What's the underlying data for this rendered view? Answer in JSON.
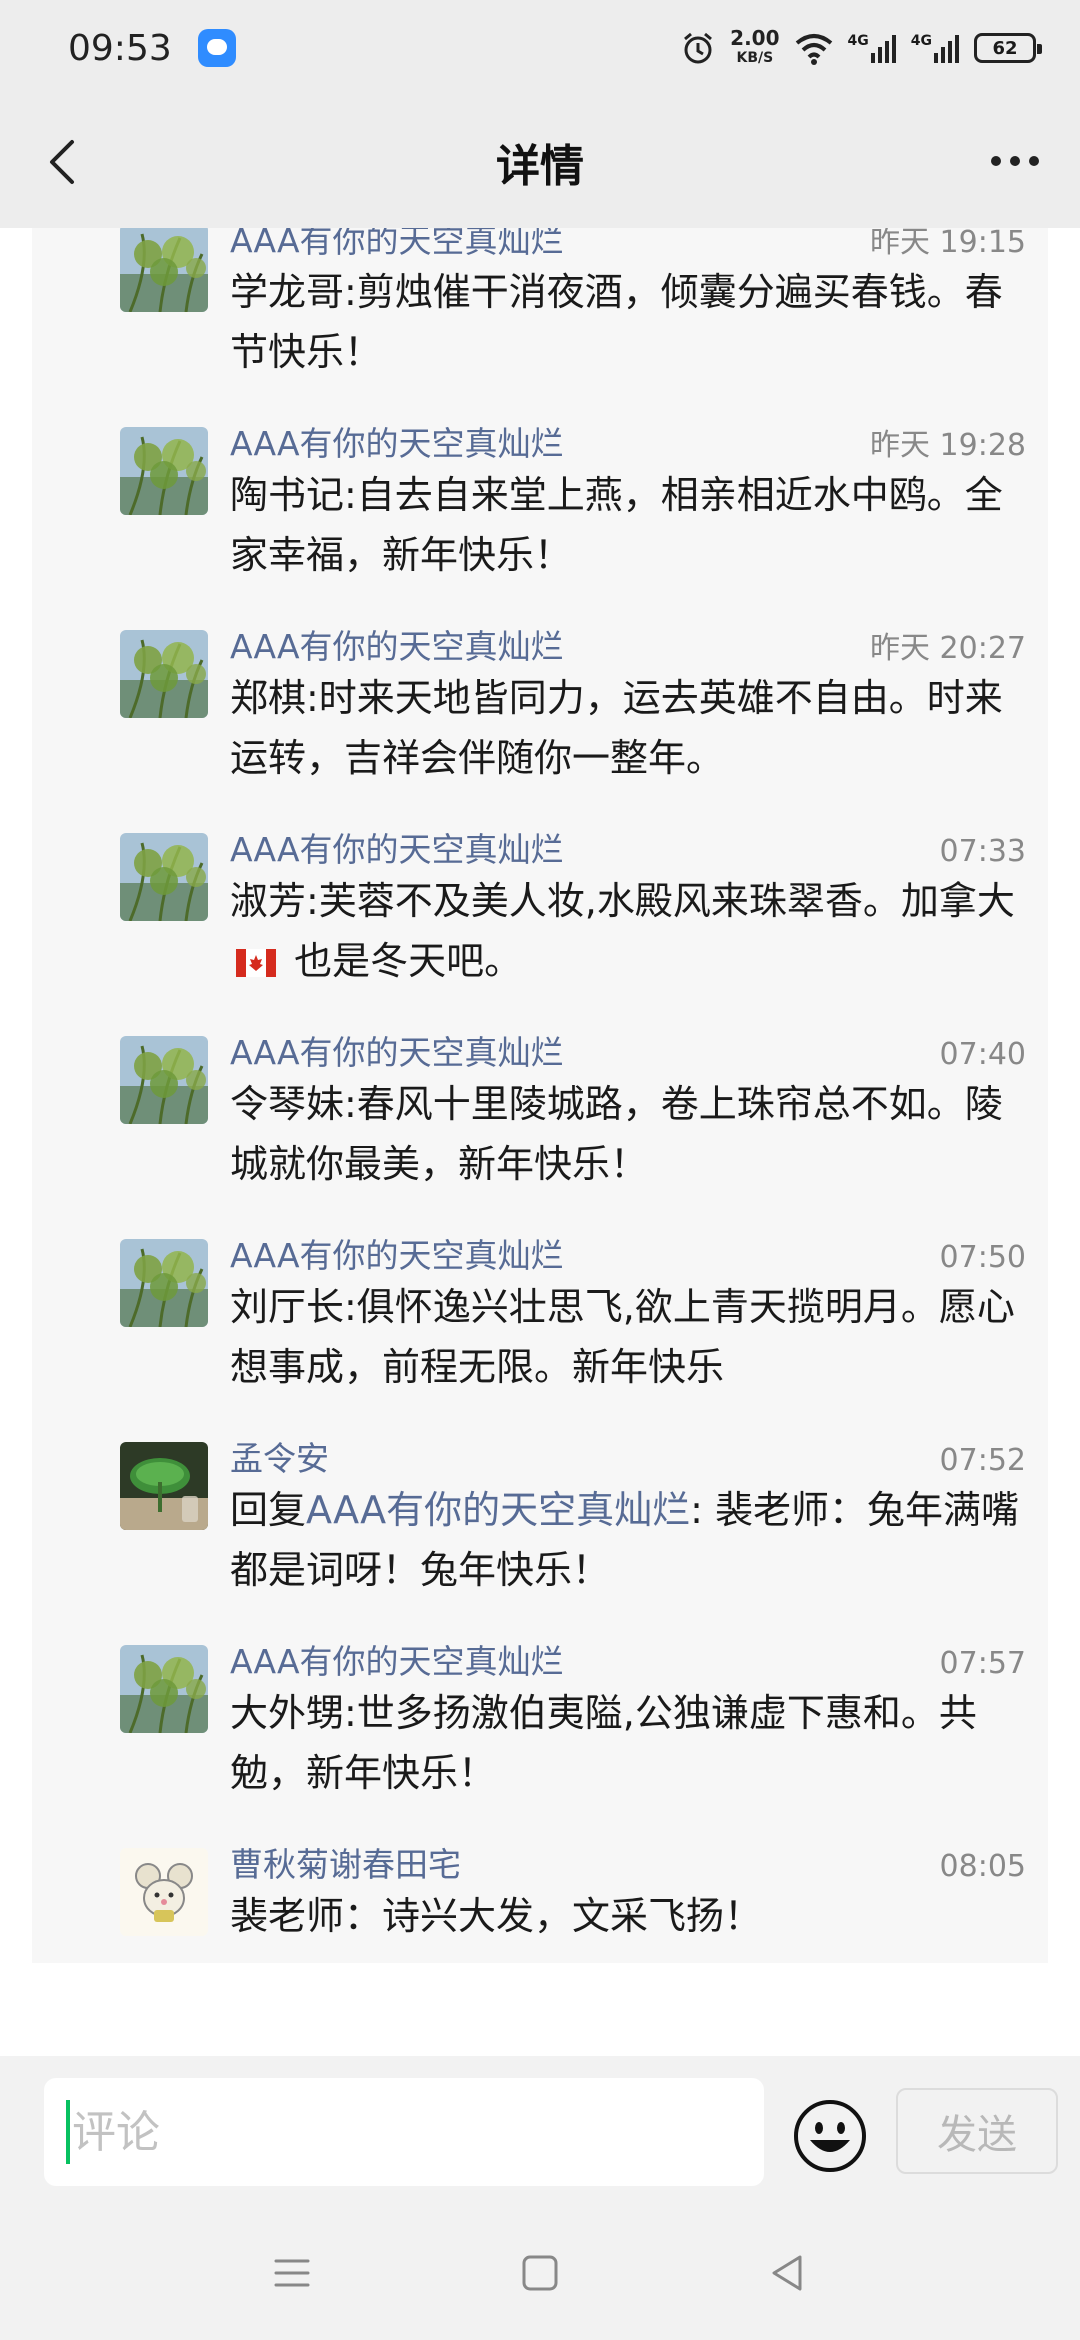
{
  "status_bar": {
    "time": "09:53",
    "speed_value": "2.00",
    "speed_unit": "KB/S",
    "network_1": "4G",
    "network_2": "4G",
    "battery": "62"
  },
  "nav": {
    "title": "详情",
    "back_icon": "chevron-left-icon",
    "more_icon": "more-dots-icon"
  },
  "comments": [
    {
      "author": "AAA有你的天空真灿烂",
      "time": "昨天 19:15",
      "text": "学龙哥:剪烛催干消夜酒，倾囊分遍买春钱。春节快乐！",
      "avatar": "landscape"
    },
    {
      "author": "AAA有你的天空真灿烂",
      "time": "昨天 19:28",
      "text": "陶书记:自去自来堂上燕，相亲相近水中鸥。全家幸福，新年快乐！",
      "avatar": "landscape"
    },
    {
      "author": "AAA有你的天空真灿烂",
      "time": "昨天 20:27",
      "text": "郑棋:时来天地皆同力，运去英雄不自由。时来运转，吉祥会伴随你一整年。",
      "avatar": "landscape"
    },
    {
      "author": "AAA有你的天空真灿烂",
      "time": "07:33",
      "text_before": "淑芳:芙蓉不及美人妆,水殿风来珠翠香。加拿大",
      "text_after": " 也是冬天吧。",
      "avatar": "landscape"
    },
    {
      "author": "AAA有你的天空真灿烂",
      "time": "07:40",
      "text": "令琴妹:春风十里陵城路，卷上珠帘总不如。陵城就你最美，新年快乐！",
      "avatar": "landscape"
    },
    {
      "author": "AAA有你的天空真灿烂",
      "time": "07:50",
      "text": "刘厅长:俱怀逸兴壮思飞,欲上青天揽明月。愿心想事成，前程无限。新年快乐",
      "avatar": "landscape"
    },
    {
      "author": "孟令安",
      "time": "07:52",
      "reply_prefix": "回复",
      "reply_target": "AAA有你的天空真灿烂",
      "text": ": 裴老师：兔年满嘴都是词呀！兔年快乐！",
      "avatar": "lotus-leaf"
    },
    {
      "author": "AAA有你的天空真灿烂",
      "time": "07:57",
      "text": "大外甥:世多扬激伯夷隘,公独谦虚下惠和。共勉，新年快乐！",
      "avatar": "landscape"
    },
    {
      "author": "曹秋菊谢春田宅",
      "time": "08:05",
      "text": "裴老师：诗兴大发，文采飞扬！",
      "avatar": "cartoon-mouse"
    }
  ],
  "input_bar": {
    "placeholder": "评论",
    "send_label": "发送",
    "emoji_icon": "smiley-icon"
  },
  "system_nav": {
    "menu_icon": "menu-icon",
    "home_icon": "home-square-icon",
    "back_icon": "back-triangle-icon"
  },
  "colors": {
    "link_blue": "#576b95",
    "caret_green": "#07c160"
  }
}
